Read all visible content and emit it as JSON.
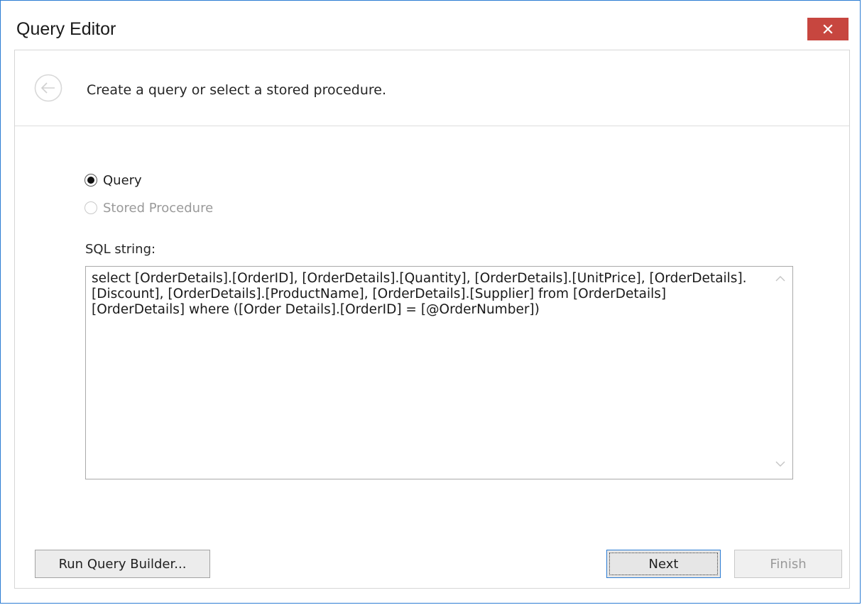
{
  "window": {
    "title": "Query Editor",
    "close_icon": "close-icon",
    "accent_color": "#2b7cd3",
    "close_color": "#c7463f"
  },
  "header": {
    "back_icon": "back-arrow-icon",
    "instruction": "Create a query or select a stored procedure."
  },
  "mode": {
    "options": [
      {
        "label": "Query",
        "selected": true,
        "enabled": true
      },
      {
        "label": "Stored Procedure",
        "selected": false,
        "enabled": false
      }
    ]
  },
  "sql": {
    "label": "SQL string:",
    "value": "select [OrderDetails].[OrderID], [OrderDetails].[Quantity], [OrderDetails].[UnitPrice], [OrderDetails].[Discount], [OrderDetails].[ProductName], [OrderDetails].[Supplier] from [OrderDetails] [OrderDetails] where ([Order Details].[OrderID] = [@OrderNumber])"
  },
  "buttons": {
    "run_query_builder": "Run Query Builder...",
    "next": "Next",
    "finish": "Finish"
  }
}
